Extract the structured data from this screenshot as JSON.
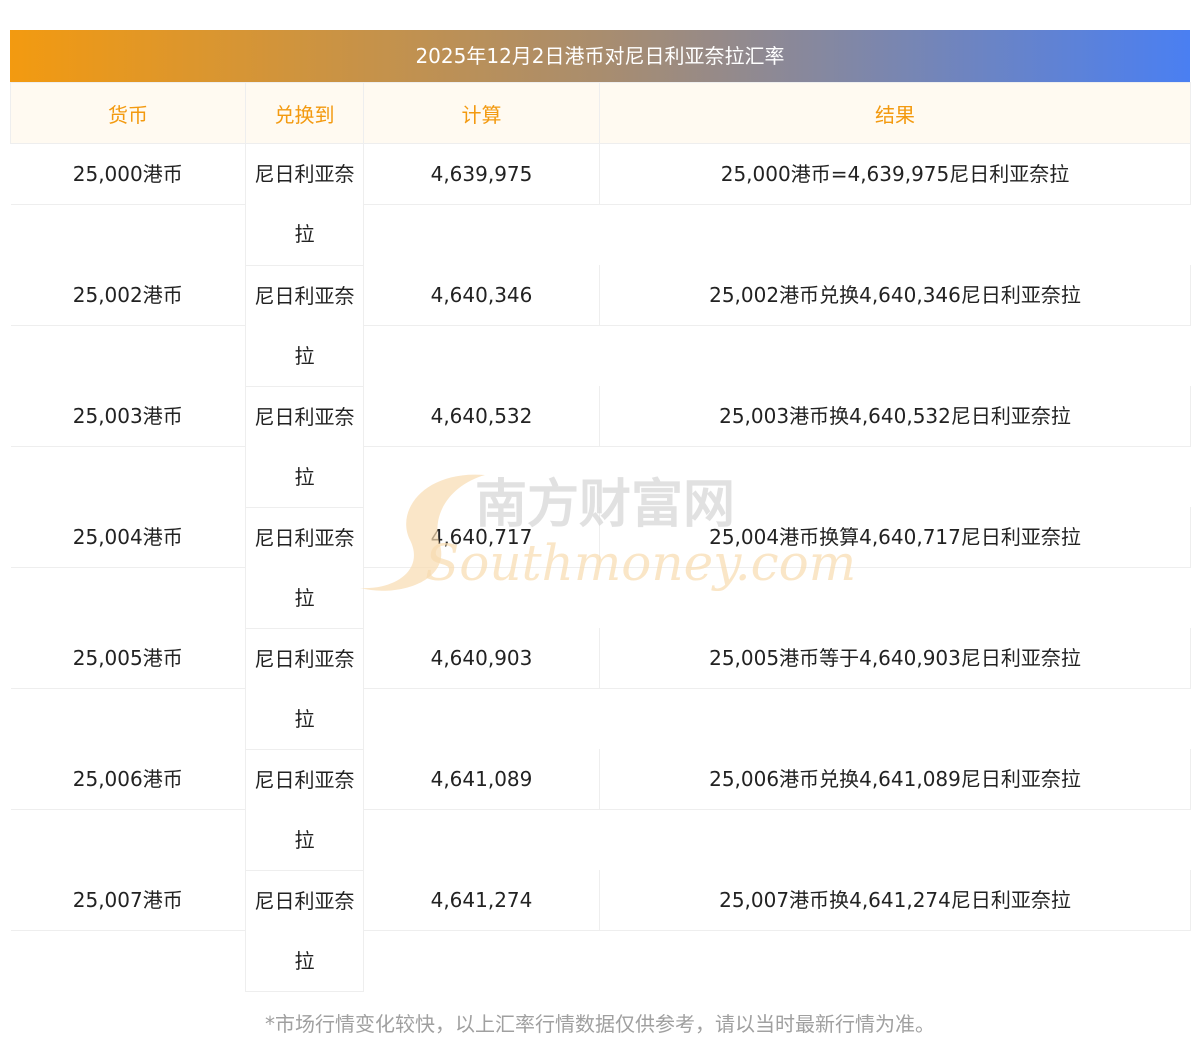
{
  "title": "2025年12月2日港币对尼日利亚奈拉汇率",
  "headers": [
    "货币",
    "兑换到",
    "计算",
    "结果"
  ],
  "rows": [
    {
      "amount": "25,000港币",
      "target": "尼日利亚奈拉",
      "calc": "4,639,975",
      "result": "25,000港币=4,639,975尼日利亚奈拉"
    },
    {
      "amount": "25,002港币",
      "target": "尼日利亚奈拉",
      "calc": "4,640,346",
      "result": "25,002港币兑换4,640,346尼日利亚奈拉"
    },
    {
      "amount": "25,003港币",
      "target": "尼日利亚奈拉",
      "calc": "4,640,532",
      "result": "25,003港币换4,640,532尼日利亚奈拉"
    },
    {
      "amount": "25,004港币",
      "target": "尼日利亚奈拉",
      "calc": "4,640,717",
      "result": "25,004港币换算4,640,717尼日利亚奈拉"
    },
    {
      "amount": "25,005港币",
      "target": "尼日利亚奈拉",
      "calc": "4,640,903",
      "result": "25,005港币等于4,640,903尼日利亚奈拉"
    },
    {
      "amount": "25,006港币",
      "target": "尼日利亚奈拉",
      "calc": "4,641,089",
      "result": "25,006港币兑换4,641,089尼日利亚奈拉"
    },
    {
      "amount": "25,007港币",
      "target": "尼日利亚奈拉",
      "calc": "4,641,274",
      "result": "25,007港币换4,641,274尼日利亚奈拉"
    }
  ],
  "footnote": "*市场行情变化较快，以上汇率行情数据仅供参考，请以当时最新行情为准。",
  "watermark": {
    "cn": "南方财富网",
    "en": "Southmoney.com"
  },
  "colors": {
    "accent": "#f39a10",
    "gradient_end": "#4a7ff2",
    "header_bg": "#fffaf1"
  }
}
